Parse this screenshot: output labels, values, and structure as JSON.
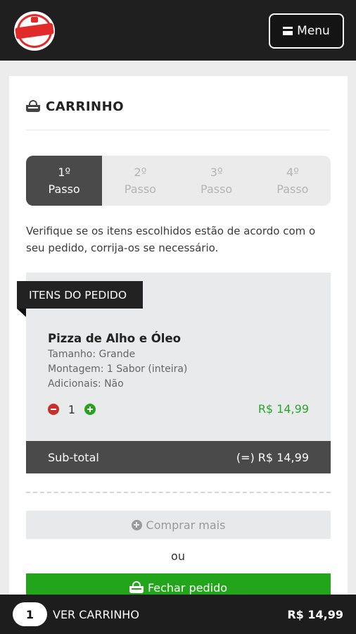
{
  "header": {
    "menu_label": "Menu"
  },
  "page": {
    "title": "CARRINHO",
    "instructions": "Verifique se os itens escolhidos estão de acordo com o seu pedido, corrija-os se necessário."
  },
  "steps": [
    {
      "number": "1º",
      "label": "Passo",
      "active": true
    },
    {
      "number": "2º",
      "label": "Passo",
      "active": false
    },
    {
      "number": "3º",
      "label": "Passo",
      "active": false
    },
    {
      "number": "4º",
      "label": "Passo",
      "active": false
    }
  ],
  "order": {
    "section_title": "ITENS DO PEDIDO",
    "item": {
      "name": "Pizza de Alho e Óleo",
      "size": "Tamanho: Grande",
      "assembly": "Montagem: 1 Sabor (inteira)",
      "extras": "Adicionais: Não",
      "quantity": "1",
      "price": "R$ 14,99"
    },
    "subtotal_label": "Sub-total",
    "subtotal_value": "(=) R$ 14,99"
  },
  "actions": {
    "buy_more": "Comprar mais",
    "or": "ou",
    "close_order": "Fechar pedido"
  },
  "cart_bar": {
    "count": "1",
    "label": "VER CARRINHO",
    "total": "R$ 14,99"
  },
  "colors": {
    "header_bg": "#1f1f1f",
    "active_step": "#4a4a4a",
    "accent_green": "#22a51b",
    "price_green": "#2ba72b",
    "minus_red": "#c9302c"
  },
  "icons": [
    "logo",
    "menu-icon",
    "basket-icon",
    "minus-circle-icon",
    "plus-circle-icon"
  ]
}
